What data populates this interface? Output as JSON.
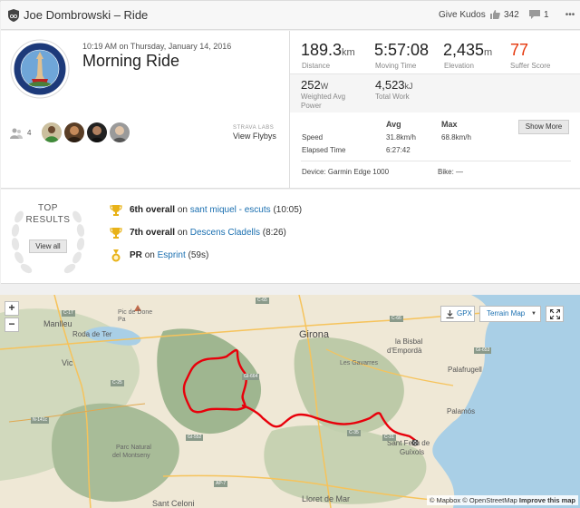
{
  "header": {
    "title": "Joe Dombrowski – Ride",
    "give_kudos": "Give Kudos",
    "kudos_count": "342",
    "comment_count": "1"
  },
  "activity": {
    "datetime": "10:19 AM on Thursday, January 14, 2016",
    "name": "Morning Ride"
  },
  "stats": {
    "distance_value": "189.3",
    "distance_unit": "km",
    "distance_label": "Distance",
    "moving_time_value": "5:57:08",
    "moving_time_label": "Moving Time",
    "elevation_value": "2,435",
    "elevation_unit": "m",
    "elevation_label": "Elevation",
    "suffer_value": "77",
    "suffer_label": "Suffer Score",
    "power_value": "252",
    "power_unit": "W",
    "power_label_1": "Weighted Avg",
    "power_label_2": "Power",
    "work_value": "4,523",
    "work_unit": "kJ",
    "work_label": "Total Work",
    "table_head_avg": "Avg",
    "table_head_max": "Max",
    "speed_label": "Speed",
    "speed_avg": "31.8km/h",
    "speed_max": "68.8km/h",
    "elapsed_label": "Elapsed Time",
    "elapsed_value": "6:27:42",
    "show_more": "Show More",
    "device": "Device: Garmin Edge 1000",
    "bike": "Bike: —"
  },
  "social": {
    "athlete_count": "4",
    "strava_labs": "STRAVA LABS",
    "view_flybys": "View Flybys"
  },
  "results": {
    "top_line1": "TOP",
    "top_line2": "RESULTS",
    "view_all": "View all",
    "items": [
      {
        "rank": "6th overall",
        "on": "on",
        "segment": "sant miquel - escuts",
        "extra": "(10:05)",
        "icon": "trophy-gold-icon"
      },
      {
        "rank": "7th overall",
        "on": "on",
        "segment": "Descens Cladells",
        "extra": "(8:26)",
        "icon": "trophy-gold-icon"
      },
      {
        "rank": "PR",
        "on": "on",
        "segment": "Esprint",
        "extra": "(59s)",
        "icon": "pr-medal-icon"
      }
    ]
  },
  "map": {
    "zoom_in": "+",
    "zoom_out": "−",
    "gpx": "GPX",
    "terrain": "Terrain Map",
    "labels": {
      "pic": "Pic de Done\nPa",
      "manlleu": "Manlleu",
      "roda": "Roda de Ter",
      "vic": "Vic",
      "girona": "Girona",
      "bisbal1": "la Bisbal",
      "bisbal2": "d'Empordà",
      "gavarres": "Les Gavarres",
      "palafrugell": "Palafrugell",
      "palamos": "Palamós",
      "santfeliu1": "Sant Feliu de",
      "santfeliu2": "Guíxols",
      "parc1": "Parc Natural",
      "parc2": "del Montseny",
      "lloret": "Lloret de Mar",
      "santceloni": "Sant Celoni"
    },
    "roads": [
      "C-17",
      "C-25",
      "N-141c",
      "GI-552",
      "AP-7",
      "C-35",
      "C-31",
      "C-66",
      "GI-653",
      "GI-664",
      "C-65"
    ],
    "attribution_1": "© Mapbox © OpenStreetMap",
    "attribution_2": "Improve this map"
  },
  "colors": {
    "accent": "#e5360a",
    "link": "#1a6fb0",
    "route": "#e8000b",
    "sea": "#a9cfe6",
    "land": "#f0ead9",
    "forest": "#9cb38f"
  }
}
